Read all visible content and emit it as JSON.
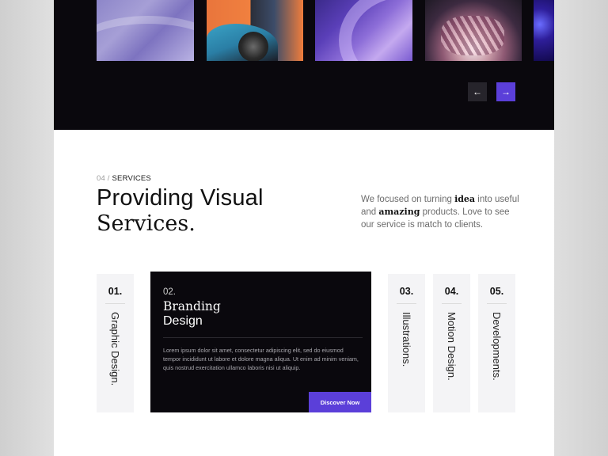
{
  "slider": {
    "images": [
      {
        "alt": "abstract-white-waves"
      },
      {
        "alt": "sports-car-orange"
      },
      {
        "alt": "purple-ribbon"
      },
      {
        "alt": "metallic-flower"
      },
      {
        "alt": "blue-particles"
      }
    ],
    "prev_icon": "←",
    "next_icon": "→",
    "next_color": "#5b3fd9"
  },
  "section": {
    "index": "04 /",
    "crumb": "SERVICES",
    "headline_light": "Providing Visual",
    "headline_serif": "Services.",
    "intro": {
      "part1": "We focused on turning ",
      "highlight1": "idea",
      "part2": " into useful and ",
      "highlight2": "amazing",
      "part3": " products. Love to see our service is match to clients."
    }
  },
  "services": [
    {
      "num": "01.",
      "label": "Graphic Design."
    },
    {
      "num": "02.",
      "title_serif": "Branding",
      "title_light": "Design",
      "description": "Lorem ipsum dolor sit amet, consectetur adipiscing elit, sed do eiusmod tempor incididunt ut labore et dolore magna aliqua. Ut enim ad minim veniam, quis nostrud exercitation ullamco laboris nisi ut aliquip.",
      "cta": "Discover Now"
    },
    {
      "num": "03.",
      "label": "Illustrations."
    },
    {
      "num": "04.",
      "label": "Motion Design."
    },
    {
      "num": "05.",
      "label": "Developments."
    }
  ],
  "colors": {
    "accent": "#5b3fd9",
    "dark": "#0a080d",
    "card_bg": "#f4f4f6"
  }
}
